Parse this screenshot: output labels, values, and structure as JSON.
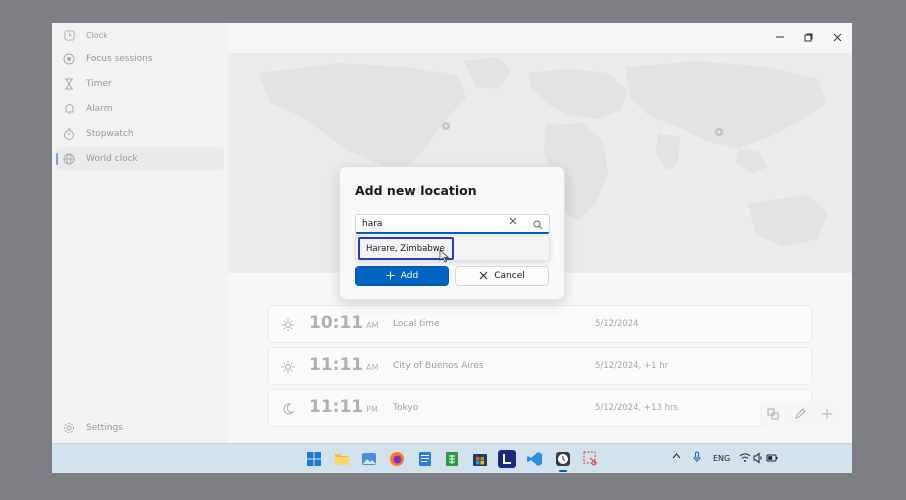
{
  "sidebar": {
    "items": [
      {
        "label": "Clock",
        "icon": "clock-icon"
      },
      {
        "label": "Focus sessions",
        "icon": "focus-icon"
      },
      {
        "label": "Timer",
        "icon": "hourglass-icon"
      },
      {
        "label": "Alarm",
        "icon": "bell-icon"
      },
      {
        "label": "Stopwatch",
        "icon": "stopwatch-icon"
      },
      {
        "label": "World clock",
        "icon": "globe-icon",
        "active": true
      }
    ],
    "settings_label": "Settings"
  },
  "world_clocks": [
    {
      "icon": "sun-icon",
      "time": "10:11",
      "ampm": "AM",
      "city": "Local time",
      "date": "5/12/2024"
    },
    {
      "icon": "sun-icon",
      "time": "11:11",
      "ampm": "AM",
      "city": "City of Buenos Aires",
      "date": "5/12/2024, +1 hr"
    },
    {
      "icon": "moon-icon",
      "time": "11:11",
      "ampm": "PM",
      "city": "Tokyo",
      "date": "5/12/2024, +13 hrs"
    }
  ],
  "dialog": {
    "title": "Add new location",
    "search_value": "hara",
    "suggestion": "Harare, Zimbabwe",
    "add_label": "Add",
    "cancel_label": "Cancel"
  },
  "taskbar": {
    "tray": {
      "language": "ENG"
    }
  },
  "colors": {
    "accent": "#0063c0",
    "highlight": "#2a36c8",
    "taskbar": "#d3e3ee"
  }
}
